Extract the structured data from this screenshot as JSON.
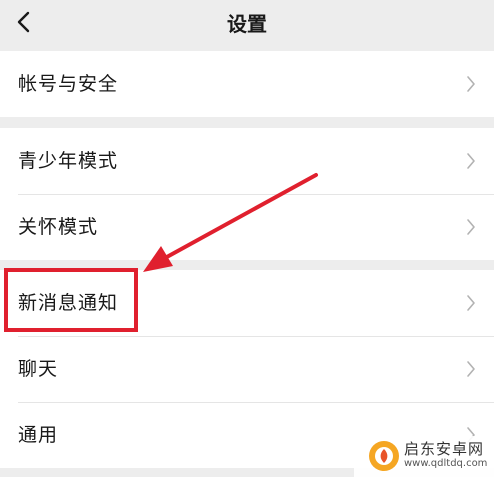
{
  "header": {
    "title": "设置",
    "back_icon": "chevron-left-icon"
  },
  "groups": [
    {
      "items": [
        {
          "label": "帐号与安全"
        }
      ]
    },
    {
      "items": [
        {
          "label": "青少年模式"
        },
        {
          "label": "关怀模式"
        }
      ]
    },
    {
      "items": [
        {
          "label": "新消息通知"
        },
        {
          "label": "聊天"
        },
        {
          "label": "通用"
        }
      ]
    }
  ],
  "annotation": {
    "color": "#e0202e",
    "target": "新消息通知"
  },
  "watermark": {
    "text": "启东安卓网",
    "url": "www.qdltdq.com"
  }
}
